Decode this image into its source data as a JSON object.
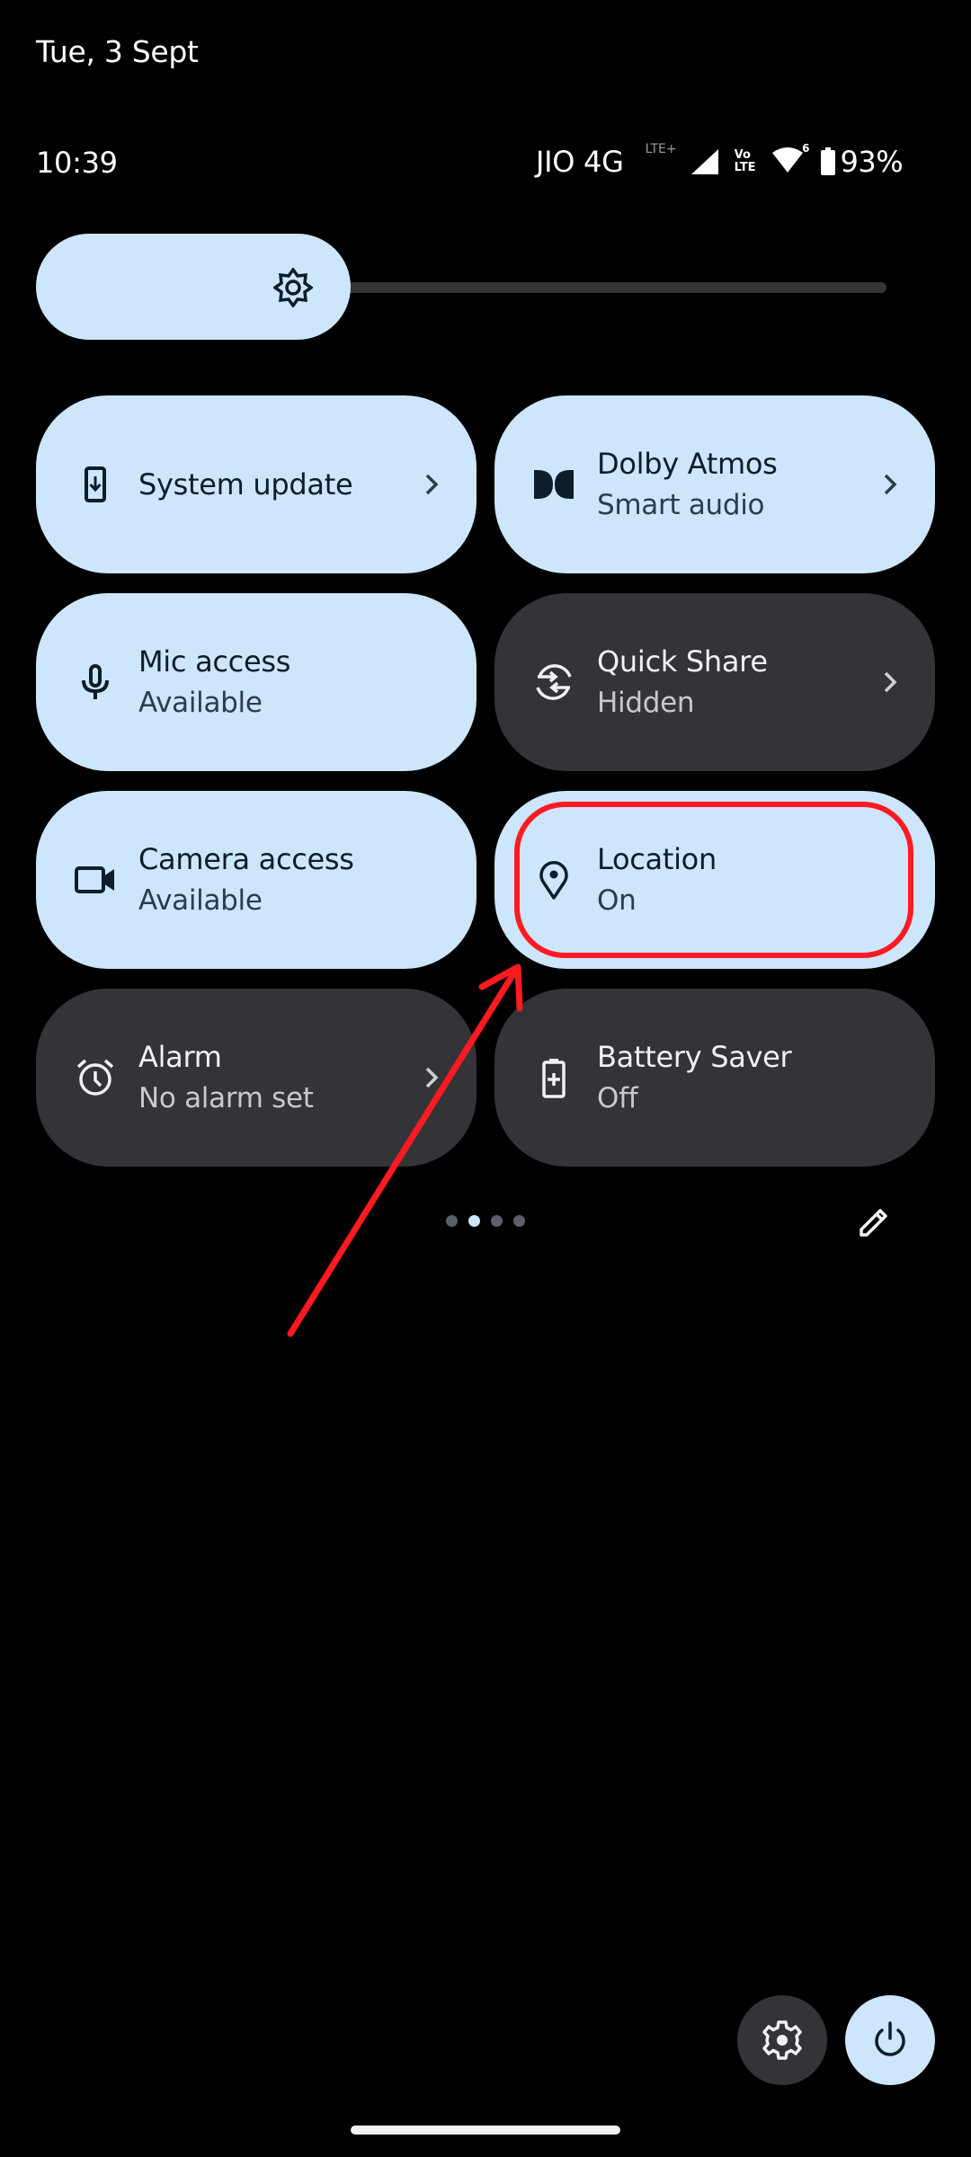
{
  "header": {
    "date": "Tue, 3 Sept",
    "time": "10:39",
    "carrier": "JIO 4G",
    "network_badge": "LTE+",
    "volte_top": "Vo",
    "volte_bottom": "LTE",
    "wifi_generation": "6",
    "battery_percent": "93%"
  },
  "brightness": {
    "icon": "brightness-icon",
    "level_fraction": 0.38
  },
  "tiles": [
    {
      "title": "System update",
      "subtitle": "",
      "icon": "system-update-icon",
      "state": "on",
      "has_chevron": true
    },
    {
      "title": "Dolby Atmos",
      "subtitle": "Smart audio",
      "icon": "dolby-icon",
      "state": "on",
      "has_chevron": true
    },
    {
      "title": "Mic access",
      "subtitle": "Available",
      "icon": "microphone-icon",
      "state": "on",
      "has_chevron": false
    },
    {
      "title": "Quick Share",
      "subtitle": "Hidden",
      "icon": "quick-share-icon",
      "state": "off",
      "has_chevron": true
    },
    {
      "title": "Camera access",
      "subtitle": "Available",
      "icon": "camera-icon",
      "state": "on",
      "has_chevron": false
    },
    {
      "title": "Location",
      "subtitle": "On",
      "icon": "location-pin-icon",
      "state": "on",
      "has_chevron": false
    },
    {
      "title": "Alarm",
      "subtitle": "No alarm set",
      "icon": "alarm-clock-icon",
      "state": "off",
      "has_chevron": true
    },
    {
      "title": "Battery Saver",
      "subtitle": "Off",
      "icon": "battery-saver-icon",
      "state": "off",
      "has_chevron": false
    }
  ],
  "pager": {
    "total": 4,
    "current": 2
  },
  "annotation": {
    "highlighted_tile": "Location",
    "color": "#ff1a22"
  },
  "colors": {
    "tile_on": "#cde6fb",
    "tile_off": "#333437",
    "background": "#000000"
  },
  "footer": {
    "settings": "settings-gear-icon",
    "power": "power-icon"
  }
}
